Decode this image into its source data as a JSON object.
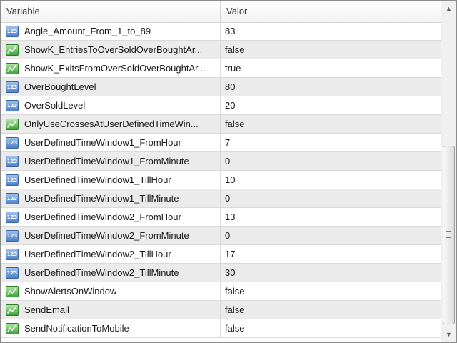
{
  "header": {
    "variable": "Variable",
    "value": "Valor"
  },
  "rows": [
    {
      "name": "Angle_Amount_From_1_to_89",
      "value": "83",
      "type": "number"
    },
    {
      "name": "ShowK_EntriesToOverSoldOverBoughtAr...",
      "value": "false",
      "type": "bool"
    },
    {
      "name": "ShowK_ExitsFromOverSoldOverBoughtAr...",
      "value": "true",
      "type": "bool"
    },
    {
      "name": "OverBoughtLevel",
      "value": "80",
      "type": "number"
    },
    {
      "name": "OverSoldLevel",
      "value": "20",
      "type": "number"
    },
    {
      "name": "OnlyUseCrossesAtUserDefinedTimeWin...",
      "value": "false",
      "type": "bool"
    },
    {
      "name": "UserDefinedTimeWindow1_FromHour",
      "value": "7",
      "type": "number"
    },
    {
      "name": "UserDefinedTimeWindow1_FromMinute",
      "value": "0",
      "type": "number"
    },
    {
      "name": "UserDefinedTimeWindow1_TillHour",
      "value": "10",
      "type": "number"
    },
    {
      "name": "UserDefinedTimeWindow1_TillMinute",
      "value": "0",
      "type": "number"
    },
    {
      "name": "UserDefinedTimeWindow2_FromHour",
      "value": "13",
      "type": "number"
    },
    {
      "name": "UserDefinedTimeWindow2_FromMinute",
      "value": "0",
      "type": "number"
    },
    {
      "name": "UserDefinedTimeWindow2_TillHour",
      "value": "17",
      "type": "number"
    },
    {
      "name": "UserDefinedTimeWindow2_TillMinute",
      "value": "30",
      "type": "number"
    },
    {
      "name": "ShowAlertsOnWindow",
      "value": "false",
      "type": "bool"
    },
    {
      "name": "SendEmail",
      "value": "false",
      "type": "bool"
    },
    {
      "name": "SendNotificationToMobile",
      "value": "false",
      "type": "bool"
    }
  ],
  "icons": {
    "number": {
      "name": "number-type-icon",
      "glyph": "123"
    },
    "bool": {
      "name": "boolean-type-icon"
    }
  },
  "colors": {
    "number_icon": "#4f82c7",
    "bool_icon": "#3fa33a",
    "alt_row": "#ebebeb"
  }
}
